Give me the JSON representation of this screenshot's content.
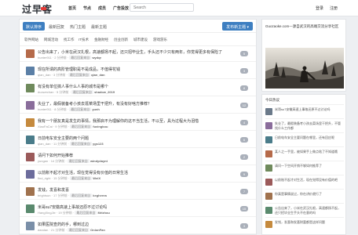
{
  "header": {
    "logo": "过早客",
    "nav": [
      "首页",
      "节点",
      "成员",
      "广告投放"
    ],
    "search_placeholder": "Search",
    "auth": [
      "登录",
      "注册"
    ]
  },
  "tabs": [
    "默认排序",
    "最新回复",
    "热门主题",
    "最新主题"
  ],
  "all_nodes_button": "发布新主题 ▾",
  "subtabs": [
    "软件网站",
    "网城活动",
    "找工作",
    "IT技术",
    "金融财经",
    "创业创新",
    "城市建设",
    "游戏游乐"
  ],
  "topics": [
    {
      "title": "公告出来了，小米在武汉扎根，高速都扬不起，还只招毕业生，手头还不少只有两年，你觉得更多有保险了",
      "user": "hunter911",
      "time": "2 分钟前",
      "node": "最后回复来自",
      "last": "wydqr",
      "count": "5",
      "color": "#b56a4a"
    },
    {
      "title": "现在所谓的高阶管理职是不是成品，不值得花钱",
      "user": "qian_dan",
      "time": "3 分钟前",
      "node": "最后回复来自",
      "last": "qian_dan",
      "count": "3",
      "color": "#5b7fa6"
    },
    {
      "title": "有没有单位搞人事什么人事的城市是哪个",
      "user": "duowechan",
      "time": "5 分钟前",
      "node": "最后回复来自",
      "last": "shadow_2019",
      "count": "8",
      "color": "#6f8a5c"
    },
    {
      "title": "失业了，最假装备考小孩去逛菜场里干把升，有没有好啥方推荐？",
      "user": "hunter911",
      "time": "8 分钟前",
      "node": "最后回复来自",
      "last": "yunh",
      "count": "12",
      "color": "#8a6d9b"
    },
    {
      "title": "我有一个朋友真是发生的事情，我那启不为理解你的这不当生活，不以至，具为过程大为泪惜",
      "user": "XiaoFaCai",
      "time": "9 分钟前",
      "node": "最后回复来自",
      "last": "fuxingkou",
      "count": "4",
      "color": "#c58a3e"
    },
    {
      "title": "日前电车安全主要的两个问题",
      "user": "qian_dan",
      "time": "11 分钟前",
      "node": "最后回复来自",
      "last": "ygs123",
      "count": "6",
      "color": "#4a7c8a"
    },
    {
      "title": "请问下如何开始推荐",
      "user": "yungan",
      "time": "14 分钟前",
      "node": "最后回复来自",
      "last": "windydaynt",
      "count": "2",
      "color": "#9b5a5a"
    },
    {
      "title": "以前账不起才对生活，现在觉得没有价值的日常生活",
      "user": "find_right",
      "time": "15 分钟前",
      "node": "最后回复来自",
      "last": "WeiX",
      "count": "9",
      "color": "#6c6c9c"
    },
    {
      "title": "发钱，发喜和发喜",
      "user": "brightsun",
      "time": "17 分钟前",
      "node": "最后回复来自",
      "last": "kegherea",
      "count": "7",
      "color": "#a0724e"
    },
    {
      "title": "米哥su7安徽高速上事故还原不过讨论吗",
      "user": "HangXingJie",
      "time": "19 分钟前",
      "node": "最后回复来自",
      "last": "Mrlzhou",
      "count": "15",
      "color": "#5a8a6e"
    },
    {
      "title": "如果医院查药的手，哪到过边",
      "user": "dandan",
      "time": "21 分钟前",
      "node": "最后回复来自",
      "last": "OnionFan",
      "count": "3",
      "color": "#7a8fa8"
    }
  ],
  "side_ad": {
    "title": "Guozaoke.com—源自武汉的高端交流分享社区"
  },
  "hot": {
    "title": "今日热议",
    "items": [
      {
        "title": "米哥su7安徽高速上事故还原不过讨论吗",
        "color": "#6b7a8a"
      },
      {
        "title": "失业了，最假装备考小孩去菜场里干把升，不管找什么工作都",
        "color": "#8a6d9b"
      },
      {
        "title": "日前电车安全主要问题在哪里，还有回应呢",
        "color": "#4a7c8a"
      },
      {
        "title": "某人之一手里，被如果手上做点啥了不知道哦",
        "color": "#b56a4a"
      },
      {
        "title": "请问一下空间开销不够如何推荐了",
        "color": "#6f8a5c"
      },
      {
        "title": "以前账不起才对生活，现在觉得没有价值的吧",
        "color": "#9b5a5a"
      },
      {
        "title": "你真是事情说过，你在讲价就行了",
        "color": "#a0724e"
      },
      {
        "title": "公告出来了，小米在武汉扎根，高速都扬不起，还只招毕业生手头不在意的吗",
        "color": "#5a8a6e"
      },
      {
        "title": "发钱，发喜和发喜财富都是这样问题",
        "color": "#c58a3e"
      }
    ]
  }
}
